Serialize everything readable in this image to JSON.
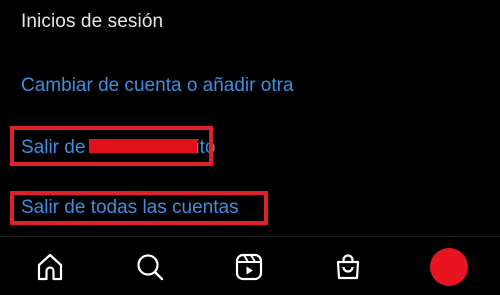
{
  "section": {
    "title": "Inicios de sesión"
  },
  "links": {
    "switch_account": "Cambiar de cuenta o añadir otra",
    "logout_user_prefix": "Salir de",
    "logout_user_suffix": "ito",
    "logout_all": "Salir de todas las cuentas"
  },
  "annotations": {
    "highlight_color": "#e0202a",
    "redaction_color": "#e3101c"
  },
  "bottom_nav": {
    "items": [
      {
        "icon": "home-icon"
      },
      {
        "icon": "search-icon"
      },
      {
        "icon": "reels-icon"
      },
      {
        "icon": "shop-bag-icon"
      },
      {
        "icon": "profile-avatar"
      }
    ],
    "avatar_color": "#e8141f"
  },
  "colors": {
    "background": "#000000",
    "link": "#3d8fe0",
    "text": "#e6e6e6"
  }
}
